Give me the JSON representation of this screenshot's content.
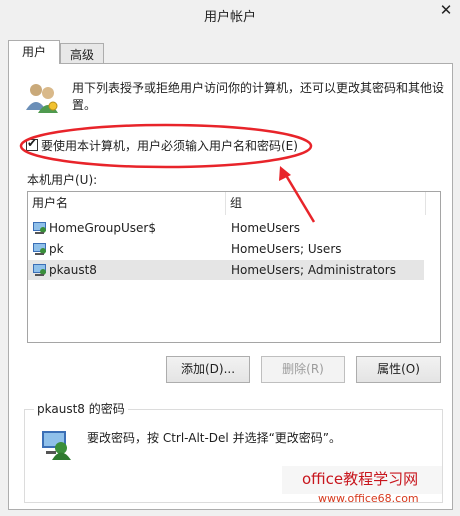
{
  "window": {
    "title": "用户帐户",
    "close_glyph": "✕"
  },
  "tabs": [
    {
      "label": "用户",
      "active": true
    },
    {
      "label": "高级",
      "active": false
    }
  ],
  "intro": {
    "icon": "users-icon",
    "text": "用下列表授予或拒绝用户访问你的计算机，还可以更改其密码和其他设置。"
  },
  "require_login": {
    "checked": true,
    "label": "要使用本计算机，用户必须输入用户名和密码(E)"
  },
  "local_users": {
    "label": "本机用户(U):",
    "columns": [
      "用户名",
      "组"
    ],
    "rows": [
      {
        "user": "HomeGroupUser$",
        "group": "HomeUsers",
        "selected": false
      },
      {
        "user": "pk",
        "group": "HomeUsers; Users",
        "selected": false
      },
      {
        "user": "pkaust8",
        "group": "HomeUsers; Administrators",
        "selected": true
      }
    ]
  },
  "buttons": {
    "add": "添加(D)...",
    "remove": "删除(R)",
    "properties": "属性(O)"
  },
  "password_section": {
    "title": "pkaust8 的密码",
    "icon": "user-key-icon",
    "text": "要改密码，按 Ctrl-Alt-Del 并选择“更改密码”。"
  },
  "watermark": {
    "line1": "office教程学习网",
    "line2": "www.office68.com"
  },
  "colors": {
    "annotation_red": "#e8242a",
    "watermark_red": "#c8161d"
  }
}
